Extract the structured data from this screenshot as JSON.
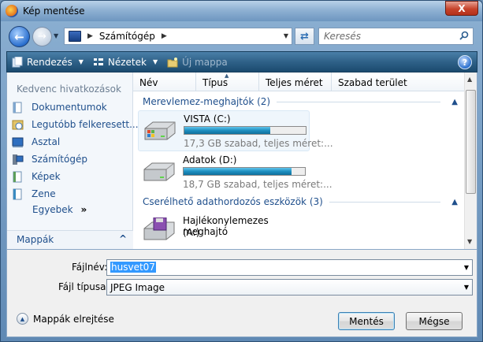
{
  "window": {
    "title": "Kép mentése",
    "close_label": "X"
  },
  "address": {
    "location": "Számítógép",
    "search_placeholder": "Keresés"
  },
  "toolbar": {
    "organize": "Rendezés",
    "views": "Nézetek",
    "new_folder": "Új mappa",
    "help": "?"
  },
  "sidebar": {
    "header": "Kedvenc hivatkozások",
    "items": [
      {
        "label": "Dokumentumok",
        "icon": "documents-icon"
      },
      {
        "label": "Legutóbb felkeresett...",
        "icon": "recent-places-icon"
      },
      {
        "label": "Asztal",
        "icon": "desktop-icon"
      },
      {
        "label": "Számítógép",
        "icon": "computer-icon"
      },
      {
        "label": "Képek",
        "icon": "pictures-icon"
      },
      {
        "label": "Zene",
        "icon": "music-icon"
      }
    ],
    "more": "Egyebek",
    "more_chevron": "»",
    "folders": "Mappák",
    "folders_chevron": "^"
  },
  "columns": [
    "Név",
    "Típus",
    "Teljes méret",
    "Szabad terület"
  ],
  "groups": {
    "hdd": "Merevlemez-meghajtók (2)",
    "removable": "Cserélhető adathordozós eszközök (3)"
  },
  "drives": [
    {
      "name": "VISTA (C:)",
      "free": "17,3 GB szabad, teljes méret:...",
      "used_fraction": 0.71
    },
    {
      "name": "Adatok (D:)",
      "free": "18,7 GB szabad, teljes méret:...",
      "used_fraction": 0.89
    }
  ],
  "floppy": {
    "name_line1": "Hajlékonylemezes meghajtó",
    "name_line2": "(A:)"
  },
  "form": {
    "filename_label": "Fájlnév:",
    "filename_value": "husvet07",
    "filetype_label": "Fájl típusa:",
    "filetype_value": "JPEG Image"
  },
  "footer": {
    "hide_folders": "Mappák elrejtése",
    "save": "Mentés",
    "cancel": "Mégse"
  }
}
